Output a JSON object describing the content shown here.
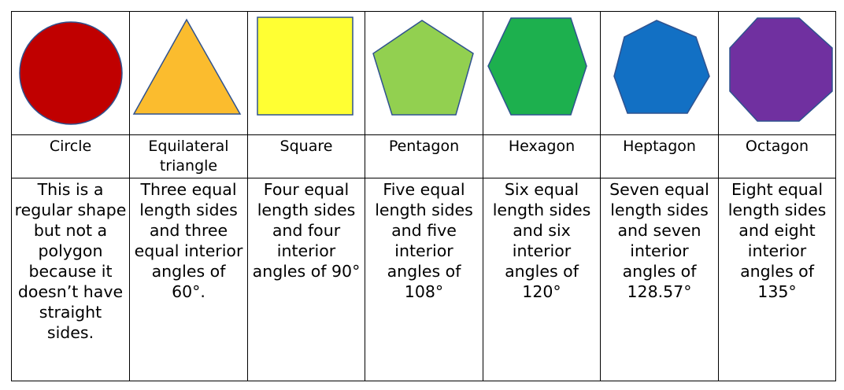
{
  "shapes": [
    {
      "id": "circle",
      "name": "Circle",
      "description": "This is a regular shape but not a polygon because it doesn’t have straight sides.",
      "fill": "#C00000",
      "stroke": "#2F528F",
      "icon": "circle-icon"
    },
    {
      "id": "equilateral-triangle",
      "name": "Equilateral triangle",
      "description": "Three equal length sides and three equal interior angles of 60°.",
      "fill": "#FBBC2E",
      "stroke": "#2F528F",
      "icon": "triangle-icon"
    },
    {
      "id": "square",
      "name": "Square",
      "description": "Four equal length sides and four interior angles of 90°",
      "fill": "#FFFF33",
      "stroke": "#2F528F",
      "icon": "square-icon"
    },
    {
      "id": "pentagon",
      "name": "Pentagon",
      "description": "Five equal length sides and five interior angles of 108°",
      "fill": "#92D050",
      "stroke": "#2F528F",
      "icon": "pentagon-icon"
    },
    {
      "id": "hexagon",
      "name": "Hexagon",
      "description": "Six equal length sides and six interior angles of 120°",
      "fill": "#1DB04E",
      "stroke": "#2F528F",
      "icon": "hexagon-icon"
    },
    {
      "id": "heptagon",
      "name": "Heptagon",
      "description": "Seven equal length sides and seven interior angles of 128.57°",
      "fill": "#1270C4",
      "stroke": "#2F528F",
      "icon": "heptagon-icon"
    },
    {
      "id": "octagon",
      "name": "Octagon",
      "description": "Eight equal length sides and eight interior angles of 135°",
      "fill": "#7030A0",
      "stroke": "#2F528F",
      "icon": "octagon-icon"
    }
  ]
}
